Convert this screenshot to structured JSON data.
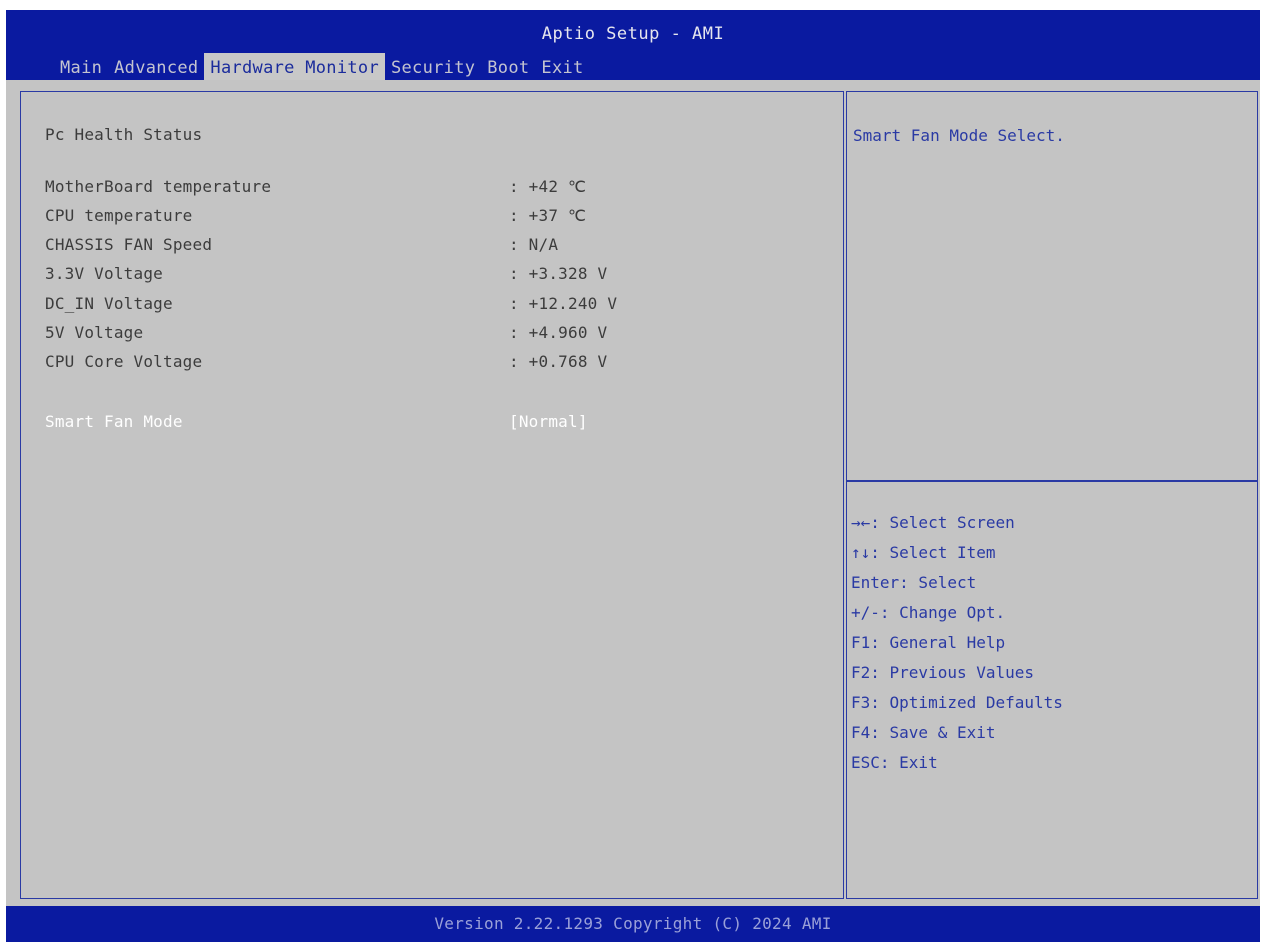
{
  "header": {
    "title": "Aptio Setup - AMI",
    "tabs": [
      {
        "label": "Main",
        "active": false
      },
      {
        "label": "Advanced",
        "active": false
      },
      {
        "label": "Hardware Monitor",
        "active": true
      },
      {
        "label": "Security",
        "active": false
      },
      {
        "label": "Boot",
        "active": false
      },
      {
        "label": "Exit",
        "active": false
      }
    ]
  },
  "main": {
    "section_title": "Pc Health Status",
    "readings": [
      {
        "label": "MotherBoard temperature",
        "value": ": +42 ℃"
      },
      {
        "label": "CPU temperature",
        "value": ": +37 ℃"
      },
      {
        "label": "CHASSIS FAN Speed",
        "value": ": N/A"
      },
      {
        "label": "3.3V Voltage",
        "value": ": +3.328 V"
      },
      {
        "label": "DC_IN Voltage",
        "value": ": +12.240 V"
      },
      {
        "label": "5V Voltage",
        "value": ": +4.960 V"
      },
      {
        "label": "CPU Core Voltage",
        "value": ": +0.768 V"
      }
    ],
    "setting": {
      "label": "Smart Fan Mode",
      "value": "[Normal]"
    }
  },
  "help": {
    "text": "Smart Fan Mode Select.",
    "keys": [
      "→←: Select Screen",
      "↑↓: Select Item",
      "Enter: Select",
      "+/-: Change Opt.",
      "F1: General Help",
      "F2: Previous Values",
      "F3: Optimized Defaults",
      "F4: Save & Exit",
      "ESC: Exit"
    ]
  },
  "footer": {
    "text": "Version 2.22.1293 Copyright (C) 2024 AMI"
  },
  "colors": {
    "header_bg": "#0a1aa0",
    "body_bg": "#c4c4c4",
    "accent_text": "#2a3aa4",
    "selected_text": "#ffffff"
  }
}
